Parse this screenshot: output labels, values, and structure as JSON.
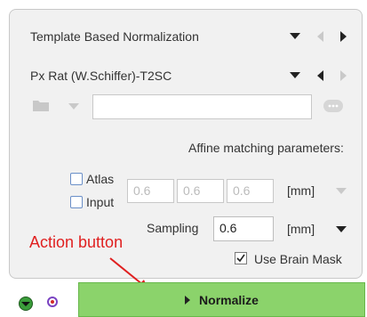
{
  "template_select": {
    "value": "Template Based Normalization"
  },
  "species_select": {
    "value": "Px Rat (W.Schiffer)-T2SC"
  },
  "path_field": {
    "value": ""
  },
  "affine": {
    "title": "Affine matching parameters:",
    "atlas_label": "Atlas",
    "input_label": "Input",
    "values": [
      "0.6",
      "0.6",
      "0.6"
    ],
    "unit": "[mm]"
  },
  "sampling": {
    "label": "Sampling",
    "value": "0.6",
    "unit": "[mm]"
  },
  "brain_mask": {
    "label": "Use Brain Mask",
    "checked": true
  },
  "annotation": {
    "text": "Action button"
  },
  "normalize_button": {
    "label": "Normalize"
  },
  "colors": {
    "button_green": "#8bd36b",
    "annotation_red": "#e02020"
  }
}
